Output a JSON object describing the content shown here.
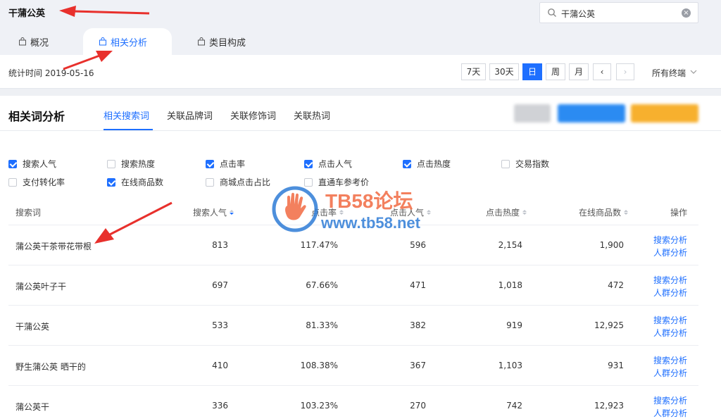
{
  "header": {
    "title": "干蒲公英",
    "search": {
      "value": "干蒲公英"
    },
    "tabs": [
      {
        "label": "概况",
        "active": false
      },
      {
        "label": "相关分析",
        "active": true
      },
      {
        "label": "类目构成",
        "active": false
      }
    ]
  },
  "datebar": {
    "stat_time": "统计时间 2019-05-16",
    "periods": [
      {
        "label": "7天",
        "active": false
      },
      {
        "label": "30天",
        "active": false
      },
      {
        "label": "日",
        "active": true
      },
      {
        "label": "周",
        "active": false
      },
      {
        "label": "月",
        "active": false
      }
    ],
    "prev": "‹",
    "next": "›",
    "terminal": "所有终端"
  },
  "panel": {
    "title": "相关词分析",
    "subtabs": [
      {
        "label": "相关搜索词",
        "active": true
      },
      {
        "label": "关联品牌词",
        "active": false
      },
      {
        "label": "关联修饰词",
        "active": false
      },
      {
        "label": "关联热词",
        "active": false
      }
    ],
    "metrics": [
      {
        "label": "搜索人气",
        "checked": true
      },
      {
        "label": "搜索热度",
        "checked": false
      },
      {
        "label": "点击率",
        "checked": true
      },
      {
        "label": "点击人气",
        "checked": true
      },
      {
        "label": "点击热度",
        "checked": true
      },
      {
        "label": "交易指数",
        "checked": false
      },
      {
        "label": "支付转化率",
        "checked": false
      },
      {
        "label": "在线商品数",
        "checked": true
      },
      {
        "label": "商城点击占比",
        "checked": false
      },
      {
        "label": "直通车参考价",
        "checked": false
      }
    ]
  },
  "table": {
    "headers": {
      "keyword": "搜索词",
      "search_pop": "搜索人气",
      "ctr": "点击率",
      "click_pop": "点击人气",
      "click_heat": "点击热度",
      "online_items": "在线商品数",
      "ops": "操作"
    },
    "rows": [
      {
        "keyword": "蒲公英干茶带花带根",
        "search_pop": "813",
        "ctr": "117.47%",
        "click_pop": "596",
        "click_heat": "2,154",
        "online_items": "1,900",
        "op1": "搜索分析",
        "op2": "人群分析"
      },
      {
        "keyword": "蒲公英叶子干",
        "search_pop": "697",
        "ctr": "67.66%",
        "click_pop": "471",
        "click_heat": "1,018",
        "online_items": "472",
        "op1": "搜索分析",
        "op2": "人群分析"
      },
      {
        "keyword": "干蒲公英",
        "search_pop": "533",
        "ctr": "81.33%",
        "click_pop": "382",
        "click_heat": "919",
        "online_items": "12,925",
        "op1": "搜索分析",
        "op2": "人群分析"
      },
      {
        "keyword": "野生蒲公英 晒干的",
        "search_pop": "410",
        "ctr": "108.38%",
        "click_pop": "367",
        "click_heat": "1,103",
        "online_items": "931",
        "op1": "搜索分析",
        "op2": "人群分析"
      },
      {
        "keyword": "蒲公英干",
        "search_pop": "336",
        "ctr": "103.23%",
        "click_pop": "270",
        "click_heat": "742",
        "online_items": "12,923",
        "op1": "搜索分析",
        "op2": "人群分析"
      }
    ]
  },
  "watermark": {
    "line1": "TB58论坛",
    "line2": "www.tb58.net"
  },
  "colors": {
    "accent": "#1e6fff",
    "arrow": "#e8302c",
    "watermark_orange": "#f26b43",
    "watermark_blue": "#2e7cd6"
  },
  "icons": [
    "search-icon",
    "clear-icon",
    "bag-icon",
    "chevron-down-icon",
    "chevron-left-icon",
    "chevron-right-icon",
    "sort-icon",
    "checkbox-icon",
    "hand-logo-icon"
  ]
}
